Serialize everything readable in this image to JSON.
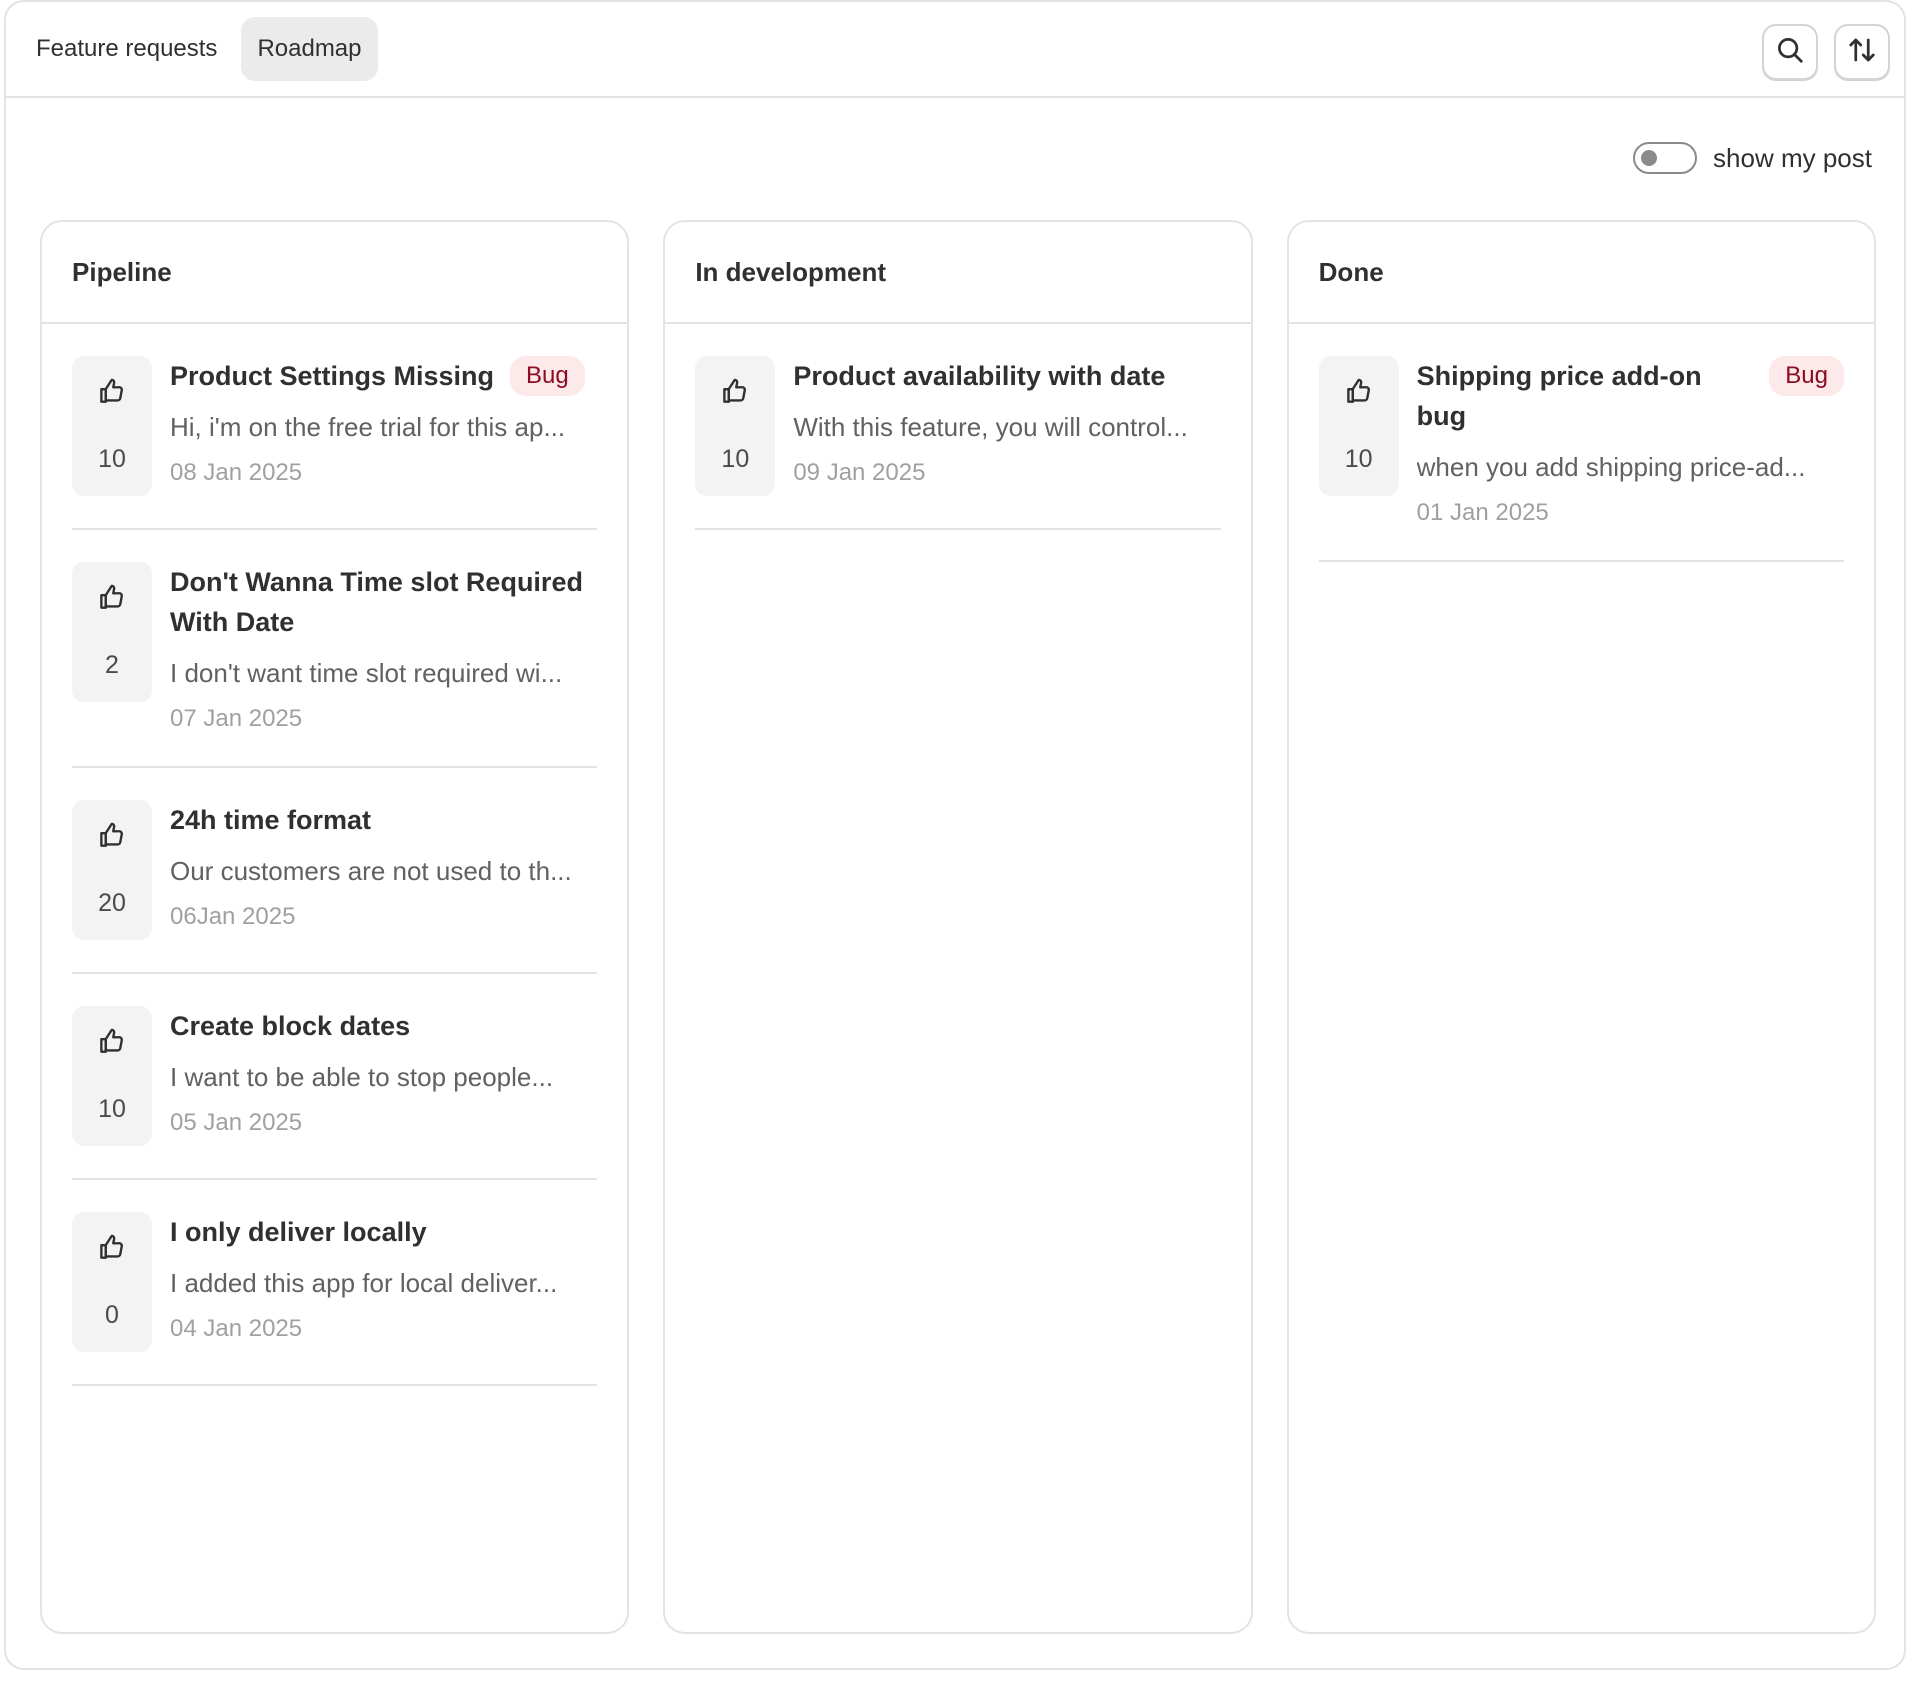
{
  "tabs": [
    {
      "label": "Feature requests",
      "active": false
    },
    {
      "label": "Roadmap",
      "active": true
    }
  ],
  "actions": {
    "search_icon": "search-icon",
    "sort_icon": "sort-arrows-icon"
  },
  "toggle": {
    "label": "show my post",
    "on": false
  },
  "colors": {
    "badge_bg": "#fde8ea",
    "badge_text": "#8e0b21",
    "border": "#e3e3e3",
    "vote_bg": "#f3f3f3"
  },
  "columns": [
    {
      "title": "Pipeline",
      "posts": [
        {
          "title": "Product Settings Missing",
          "badge": "Bug",
          "desc": "Hi, i'm on the free trial for this ap...",
          "date": "08 Jan 2025",
          "votes": "10"
        },
        {
          "title": "Don't Wanna Time slot Required With Date",
          "badge": "",
          "desc": "I don't want time slot required wi...",
          "date": "07 Jan 2025",
          "votes": "2"
        },
        {
          "title": "24h time format",
          "badge": "",
          "desc": "Our customers are not used to th...",
          "date": "06Jan 2025",
          "votes": "20"
        },
        {
          "title": "Create block dates",
          "badge": "",
          "desc": "I want to be able to stop people...",
          "date": "05 Jan 2025",
          "votes": "10"
        },
        {
          "title": "I only deliver locally",
          "badge": "",
          "desc": "I added this app for local deliver...",
          "date": "04 Jan 2025",
          "votes": "0"
        }
      ]
    },
    {
      "title": "In development",
      "posts": [
        {
          "title": "Product availability with date",
          "badge": "",
          "desc": "With this feature, you will control...",
          "date": "09 Jan 2025",
          "votes": "10"
        }
      ]
    },
    {
      "title": "Done",
      "posts": [
        {
          "title": "Shipping price add-on bug",
          "badge": "Bug",
          "desc": "when you add shipping price-ad...",
          "date": "01 Jan 2025",
          "votes": "10"
        }
      ]
    }
  ]
}
